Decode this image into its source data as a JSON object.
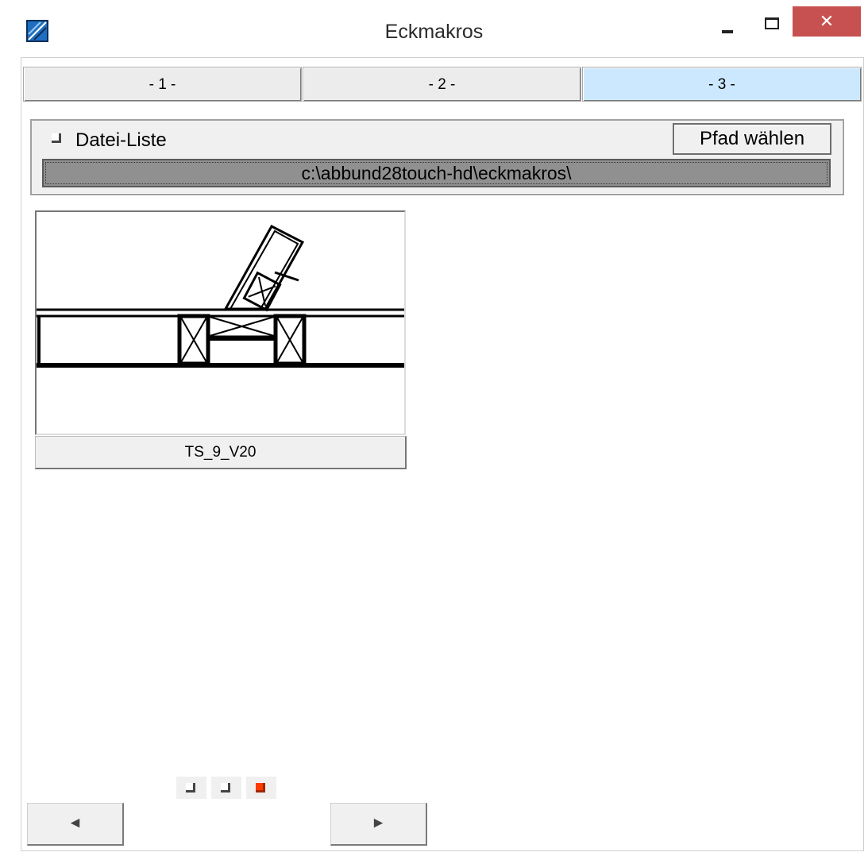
{
  "window": {
    "title": "Eckmakros",
    "close_glyph": "✕"
  },
  "tabs": [
    {
      "label": "- 1 -",
      "active": false
    },
    {
      "label": "- 2 -",
      "active": false
    },
    {
      "label": "- 3 -",
      "active": true
    }
  ],
  "file_panel": {
    "checkbox_label": "Datei-Liste",
    "checkbox_checked": false,
    "choose_path_label": "Pfad wählen",
    "path": "c:\\abbund28touch-hd\\eckmakros\\"
  },
  "macros": [
    {
      "name": "TS_9_V20",
      "icon": "wall-corner-macro-drawing"
    }
  ],
  "pagination": {
    "pages": 3,
    "current_page": 3
  },
  "navigation": {
    "prev_glyph": "◄",
    "next_glyph": "►"
  },
  "colors": {
    "active_tab": "#cce8ff",
    "close_button": "#c75050",
    "current_page_marker": "#ff3a00"
  }
}
